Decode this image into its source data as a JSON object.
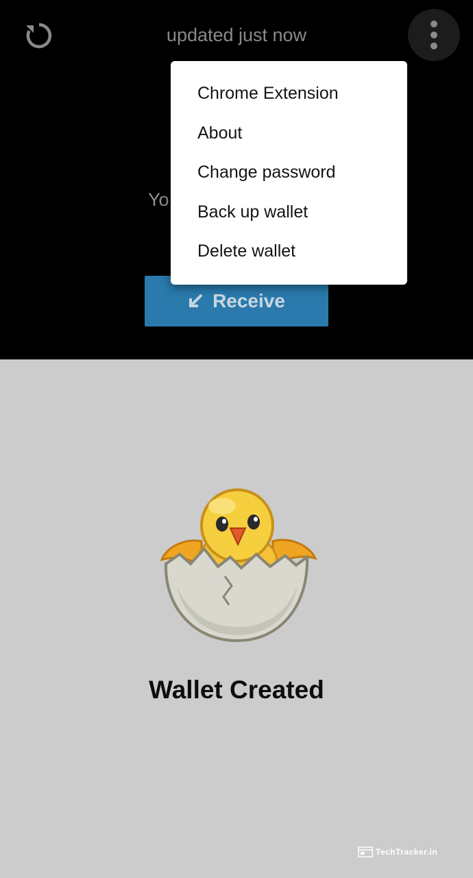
{
  "header": {
    "status_text": "updated just now",
    "refresh_icon": "refresh-icon",
    "menu_icon": "more-vertical-icon"
  },
  "balance": {
    "hint_text": "Yo"
  },
  "actions": {
    "receive_label": "Receive",
    "receive_icon": "arrow-down-left-icon"
  },
  "menu": {
    "items": [
      {
        "label": "Chrome Extension"
      },
      {
        "label": "About"
      },
      {
        "label": "Change password"
      },
      {
        "label": "Back up wallet"
      },
      {
        "label": "Delete wallet"
      }
    ]
  },
  "main": {
    "title": "Wallet Created",
    "illustration": "hatching-chick-icon"
  },
  "watermark": {
    "text": "TechTracker.in"
  },
  "colors": {
    "top_background": "#000000",
    "bottom_background": "#cccccc",
    "receive_button": "#2a7aad",
    "menu_background": "#ffffff"
  }
}
